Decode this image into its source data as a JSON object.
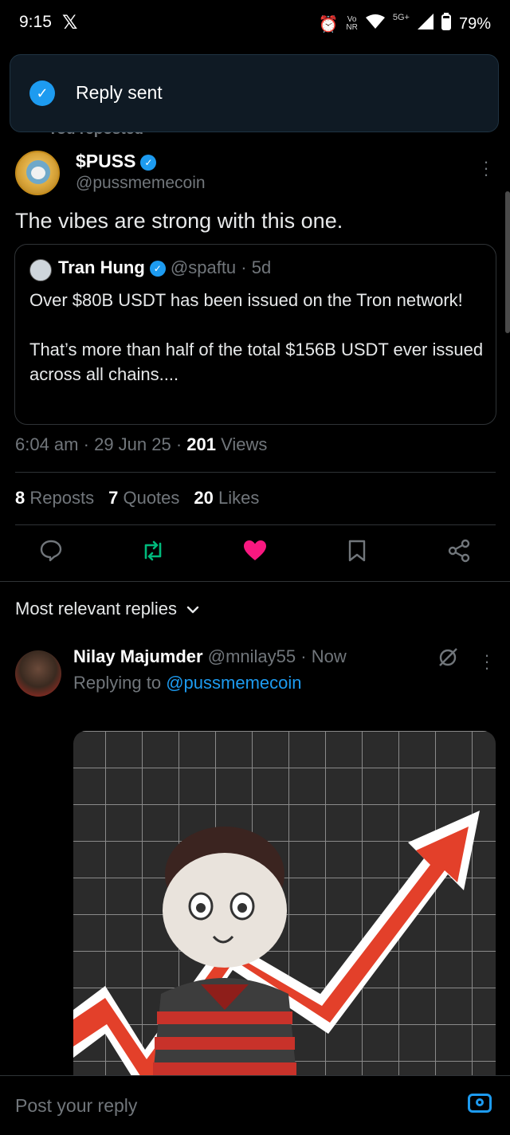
{
  "status_bar": {
    "time": "9:15",
    "app_icon": "x-logo-icon",
    "volte": "Vo",
    "nr": "NR",
    "network": "5G+",
    "battery": "79%",
    "icons": [
      "alarm-icon",
      "volte-icon",
      "wifi-icon",
      "signal-icon",
      "battery-icon"
    ]
  },
  "toast": {
    "message": "Reply sent",
    "icon": "check-circle-icon"
  },
  "reposted_label": "You reposted",
  "tweet": {
    "author_name": "$PUSS",
    "author_handle": "@pussmemecoin",
    "text": "The vibes are strong with this one.",
    "quote": {
      "author_name": "Tran Hung",
      "author_handle": "@spaftu",
      "age": "5d",
      "paragraph1": "Over $80B USDT has been issued on the Tron network!",
      "paragraph2": "That’s more than half of the total $156B USDT ever issued across all chains...."
    },
    "time": "6:04 am",
    "date": "29 Jun 25",
    "views_count": "201",
    "views_label": "Views",
    "reposts_count": "8",
    "reposts_label": "Reposts",
    "quotes_count": "7",
    "quotes_label": "Quotes",
    "likes_count": "20",
    "likes_label": "Likes",
    "colors": {
      "repost_active": "#00ba7c",
      "like_active": "#f91880",
      "accent": "#1d9bf0"
    }
  },
  "replies": {
    "sort_label": "Most relevant replies",
    "items": [
      {
        "author_name": "Nilay Majumder",
        "author_handle": "@mnilay55",
        "age": "Now",
        "replying_prefix": "Replying to",
        "replying_to": "@pussmemecoin",
        "media": "cartoon-character-rising-arrow-image"
      }
    ]
  },
  "composer": {
    "placeholder": "Post your reply",
    "icon": "camera-icon"
  }
}
